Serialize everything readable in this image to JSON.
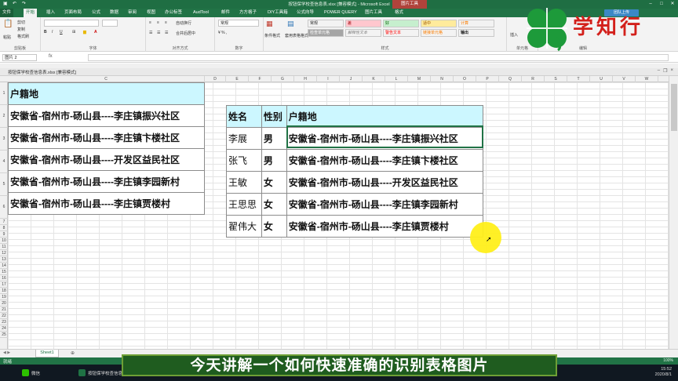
{
  "window": {
    "title": "按钮保学校查信息表.xlsx [兼容模式] - Microsoft Excel",
    "context_tab": "图片工具",
    "minimize": "–",
    "maximize": "□",
    "close": "✕"
  },
  "ribbon": {
    "tabs": [
      "文件",
      "开始",
      "插入",
      "页面布局",
      "公式",
      "数据",
      "审阅",
      "视图",
      "办公标签",
      "AudTool",
      "邮件",
      "方方格子",
      "DIY工具箱",
      "公式向导",
      "POWER QUERY",
      "图片工具",
      "格式"
    ],
    "active_tab": "开始",
    "share": "团队上传",
    "clipboard": {
      "cut": "剪切",
      "copy": "复制",
      "format_painter": "格式刷",
      "paste": "粘贴",
      "label": "剪贴板"
    },
    "font": {
      "label": "字体"
    },
    "alignment": {
      "wrap": "自动换行",
      "merge": "合并后居中",
      "label": "对齐方式"
    },
    "number": {
      "format": "常规",
      "label": "数字"
    },
    "styles": {
      "conditional": "条件格式",
      "table_format": "套用表格格式",
      "cells": [
        {
          "text": "常规",
          "bg": "#ffffff"
        },
        {
          "text": "差",
          "bg": "#ffc7ce"
        },
        {
          "text": "好",
          "bg": "#c6efce"
        },
        {
          "text": "适中",
          "bg": "#ffeb9c"
        },
        {
          "text": "计算",
          "bg": "#f2f2f2"
        },
        {
          "text": "检查单元格",
          "bg": "#a5a5a5"
        },
        {
          "text": "解释性文本",
          "bg": "#ffffff"
        },
        {
          "text": "警告文本",
          "bg": "#ffffff"
        },
        {
          "text": "链接单元格",
          "bg": "#ffffff"
        },
        {
          "text": "输出",
          "bg": "#f2f2f2"
        }
      ],
      "label": "样式"
    },
    "cells_group": {
      "insert": "插入",
      "label": "单元格"
    },
    "editing": {
      "label": "编辑"
    }
  },
  "formula_bar": {
    "name_box": "图片 2",
    "fx": "fx",
    "value": ""
  },
  "workbook": {
    "name": "按钮保学校查信息表.xlsx [兼容模式]"
  },
  "columns": [
    "A",
    "B",
    "C",
    "D",
    "E",
    "F",
    "G",
    "H",
    "I",
    "J",
    "K",
    "L",
    "M",
    "N",
    "O",
    "P",
    "Q",
    "R",
    "S",
    "T",
    "U",
    "V",
    "W"
  ],
  "rows": [
    "1",
    "2",
    "3",
    "4",
    "5",
    "6",
    "7",
    "8",
    "9",
    "10",
    "11",
    "12",
    "13",
    "14",
    "15",
    "16",
    "17",
    "18",
    "19",
    "20",
    "21",
    "22",
    "23",
    "24",
    "25"
  ],
  "left_table": {
    "header": "户籍地",
    "rows": [
      "安徽省-宿州市-砀山县----李庄镇振兴社区",
      "安徽省-宿州市-砀山县----李庄镇卞楼社区",
      "安徽省-宿州市-砀山县----开发区益民社区",
      "安徽省-宿州市-砀山县----李庄镇李园新村",
      "安徽省-宿州市-砀山县----李庄镇贾楼村"
    ]
  },
  "right_table": {
    "headers": [
      "姓名",
      "性别",
      "户籍地"
    ],
    "rows": [
      [
        "李展",
        "男",
        "安徽省-宿州市-砀山县----李庄镇振兴社区"
      ],
      [
        "张飞",
        "男",
        "安徽省-宿州市-砀山县----李庄镇卞楼社区"
      ],
      [
        "王敏",
        "女",
        "安徽省-宿州市-砀山县----开发区益民社区"
      ],
      [
        "王思思",
        "女",
        "安徽省-宿州市-砀山县----李庄镇李园新村"
      ],
      [
        "翟伟大",
        "女",
        "安徽省-宿州市-砀山县----李庄镇贾楼村"
      ]
    ]
  },
  "sheets": {
    "tabs": [
      "Sheet1"
    ],
    "add": "⊕",
    "nav": "◀ ▶"
  },
  "status": {
    "ready": "就绪",
    "zoom": "100%"
  },
  "taskbar": {
    "items": [
      "微信",
      "按钮保学校查信息..."
    ],
    "time": "15:52",
    "date": "2020/8/1"
  },
  "subtitle": "今天讲解一个如何快速准确的识别表格图片",
  "logo": {
    "text": "学知行",
    "clover_color": "#1d9a3a",
    "text_color": "#d3201b"
  }
}
